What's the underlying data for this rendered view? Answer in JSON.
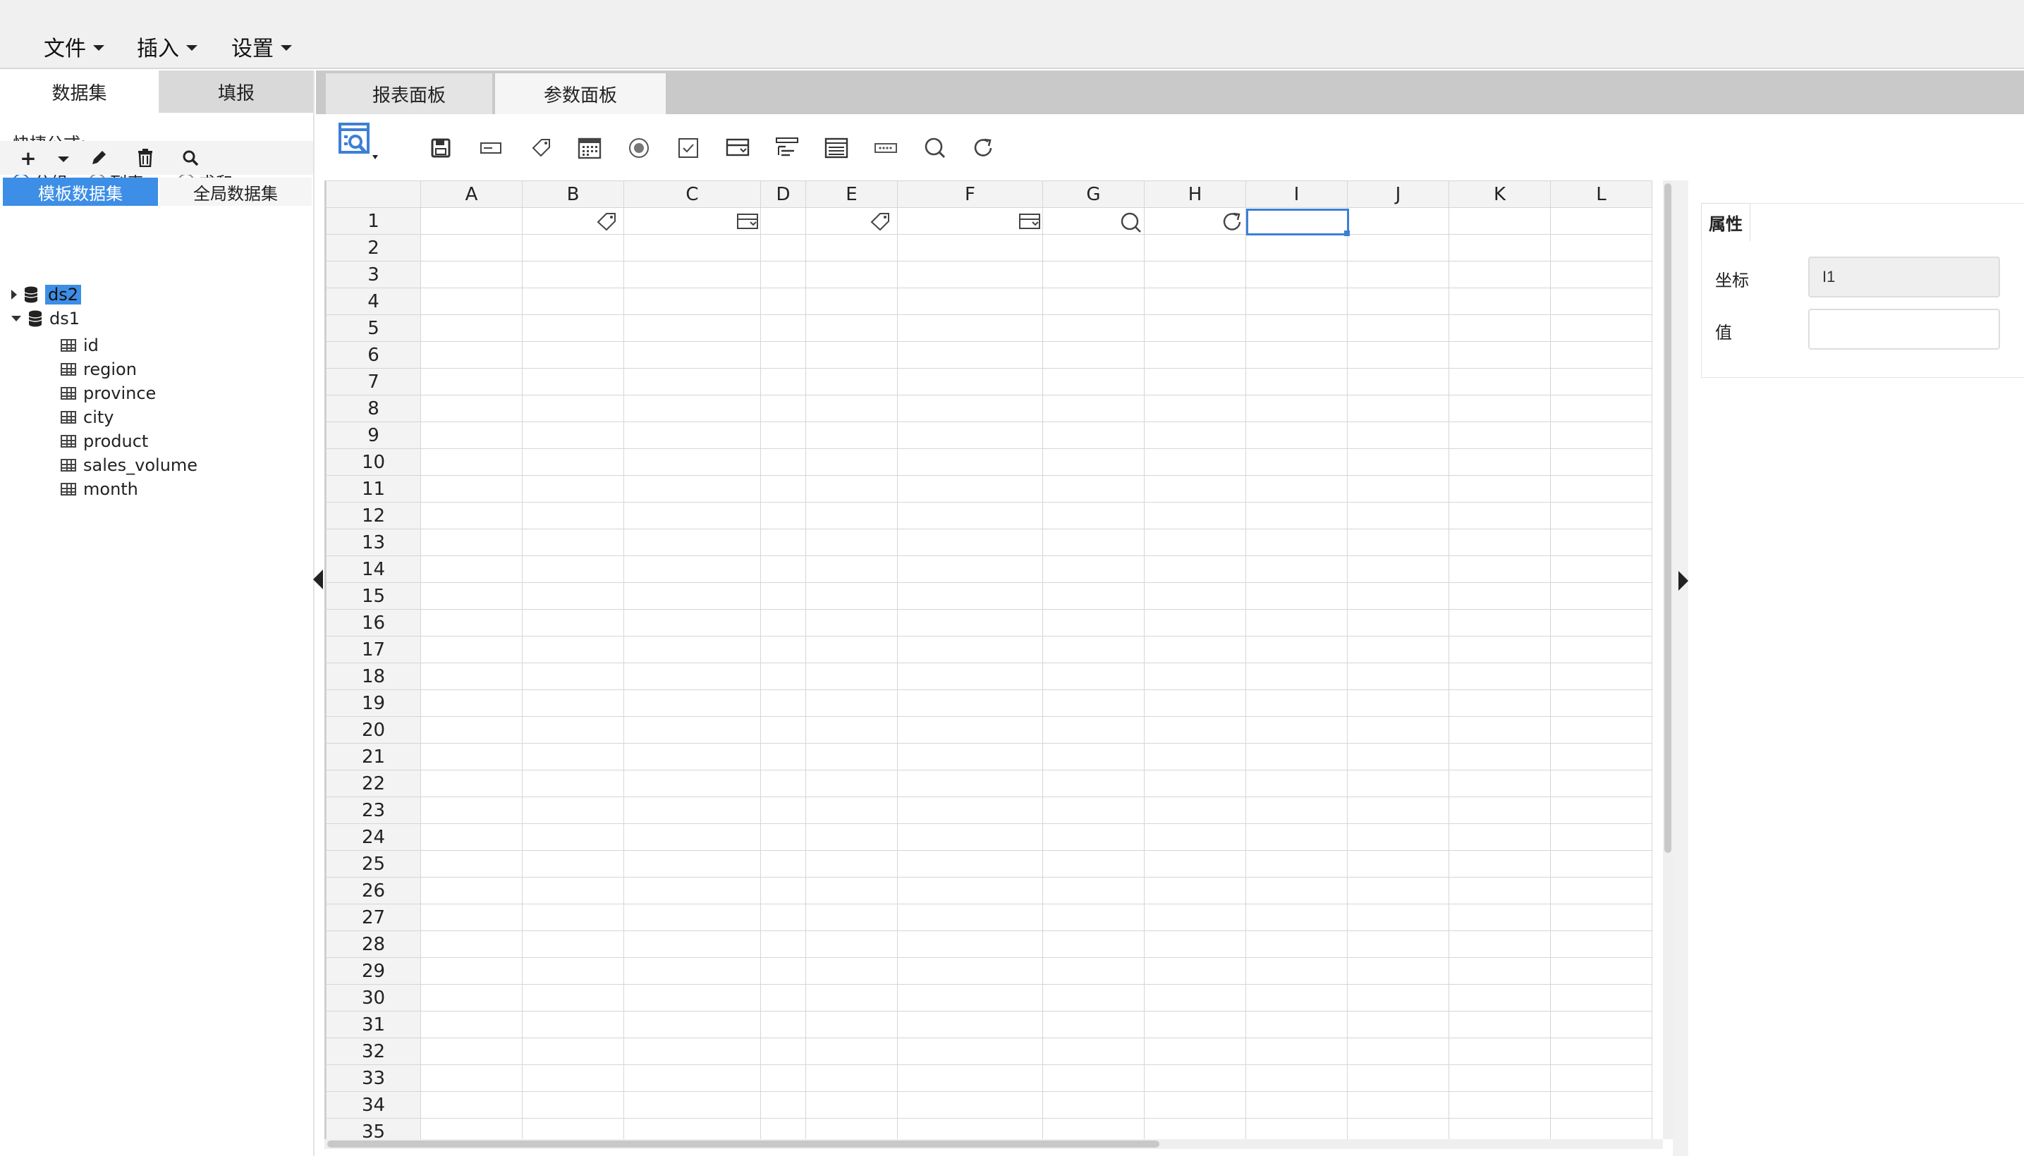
{
  "menu": {
    "file": "文件",
    "insert": "插入",
    "settings": "设置"
  },
  "left_panel": {
    "tabs": [
      "数据集",
      "填报"
    ],
    "quick_formula_label": "快捷公式:",
    "radios": [
      {
        "label": "分组",
        "checked": true
      },
      {
        "label": "列表",
        "checked": false
      },
      {
        "label": "求和",
        "checked": false
      }
    ],
    "dataset_tabs": [
      "模板数据集",
      "全局数据集"
    ],
    "tree": {
      "ds2": "ds2",
      "ds1": "ds1",
      "fields": [
        "id",
        "region",
        "province",
        "city",
        "product",
        "sales_volume",
        "month"
      ]
    }
  },
  "center": {
    "tabs": [
      "报表面板",
      "参数面板"
    ],
    "columns": [
      "A",
      "B",
      "C",
      "D",
      "E",
      "F",
      "G",
      "H",
      "I",
      "J",
      "K",
      "L"
    ],
    "rows": 35,
    "selected_cell": "I1"
  },
  "props": {
    "tab": "属性",
    "coord_label": "坐标",
    "coord_value": "I1",
    "value_label": "值",
    "value_value": ""
  }
}
